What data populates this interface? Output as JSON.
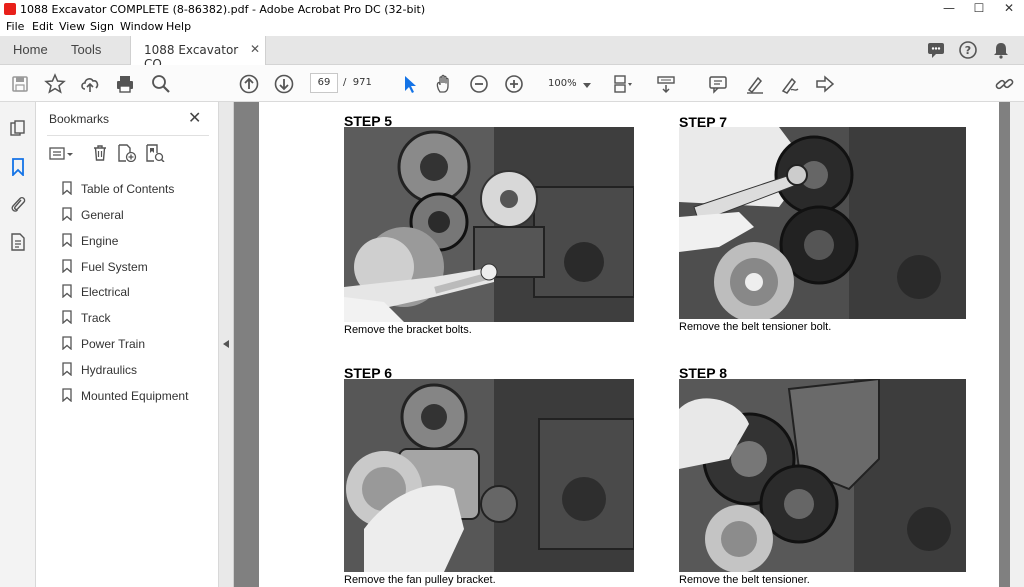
{
  "window": {
    "title": "1088 Excavator COMPLETE (8-86382).pdf - Adobe Acrobat Pro DC (32-bit)",
    "minimize": "—",
    "maximize": "☐",
    "close": "✕"
  },
  "menu": [
    "File",
    "Edit",
    "View",
    "Sign",
    "Window",
    "Help"
  ],
  "tabs": {
    "home": "Home",
    "tools": "Tools",
    "document": "1088 Excavator CO...",
    "document_close": "✕"
  },
  "toolbar": {
    "current_page": "69",
    "page_separator": "/",
    "total_pages": "971",
    "zoom": "100%"
  },
  "bookmarks": {
    "header": "Bookmarks",
    "close": "✕",
    "items": [
      "Table of Contents",
      "General",
      "Engine",
      "Fuel System",
      "Electrical",
      "Track",
      "Power Train",
      "Hydraulics",
      "Mounted Equipment"
    ]
  },
  "document": {
    "steps": [
      {
        "label": "STEP 5",
        "caption": "Remove the bracket bolts."
      },
      {
        "label": "STEP 7",
        "caption": "Remove the belt tensioner bolt."
      },
      {
        "label": "STEP 6",
        "caption": "Remove the fan pulley bracket."
      },
      {
        "label": "STEP 8",
        "caption": "Remove the belt tensioner."
      }
    ]
  },
  "colors": {
    "acrobat_red": "#e8201a",
    "tool_blue": "#1473e6"
  }
}
